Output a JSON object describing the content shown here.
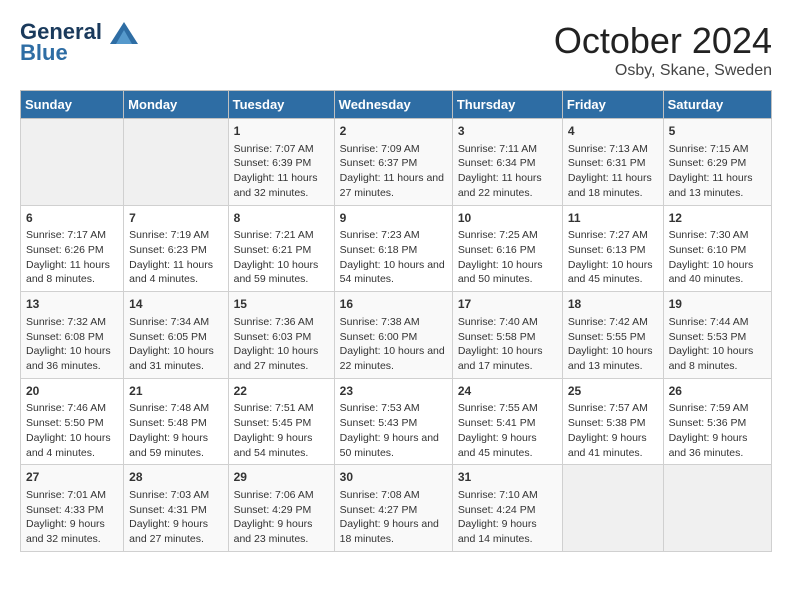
{
  "header": {
    "logo_line1": "General",
    "logo_line2": "Blue",
    "month": "October 2024",
    "location": "Osby, Skane, Sweden"
  },
  "weekdays": [
    "Sunday",
    "Monday",
    "Tuesday",
    "Wednesday",
    "Thursday",
    "Friday",
    "Saturday"
  ],
  "weeks": [
    [
      {
        "day": "",
        "empty": true
      },
      {
        "day": "",
        "empty": true
      },
      {
        "day": "1",
        "sunrise": "7:07 AM",
        "sunset": "6:39 PM",
        "daylight": "11 hours and 32 minutes."
      },
      {
        "day": "2",
        "sunrise": "7:09 AM",
        "sunset": "6:37 PM",
        "daylight": "11 hours and 27 minutes."
      },
      {
        "day": "3",
        "sunrise": "7:11 AM",
        "sunset": "6:34 PM",
        "daylight": "11 hours and 22 minutes."
      },
      {
        "day": "4",
        "sunrise": "7:13 AM",
        "sunset": "6:31 PM",
        "daylight": "11 hours and 18 minutes."
      },
      {
        "day": "5",
        "sunrise": "7:15 AM",
        "sunset": "6:29 PM",
        "daylight": "11 hours and 13 minutes."
      }
    ],
    [
      {
        "day": "6",
        "sunrise": "7:17 AM",
        "sunset": "6:26 PM",
        "daylight": "11 hours and 8 minutes."
      },
      {
        "day": "7",
        "sunrise": "7:19 AM",
        "sunset": "6:23 PM",
        "daylight": "11 hours and 4 minutes."
      },
      {
        "day": "8",
        "sunrise": "7:21 AM",
        "sunset": "6:21 PM",
        "daylight": "10 hours and 59 minutes."
      },
      {
        "day": "9",
        "sunrise": "7:23 AM",
        "sunset": "6:18 PM",
        "daylight": "10 hours and 54 minutes."
      },
      {
        "day": "10",
        "sunrise": "7:25 AM",
        "sunset": "6:16 PM",
        "daylight": "10 hours and 50 minutes."
      },
      {
        "day": "11",
        "sunrise": "7:27 AM",
        "sunset": "6:13 PM",
        "daylight": "10 hours and 45 minutes."
      },
      {
        "day": "12",
        "sunrise": "7:30 AM",
        "sunset": "6:10 PM",
        "daylight": "10 hours and 40 minutes."
      }
    ],
    [
      {
        "day": "13",
        "sunrise": "7:32 AM",
        "sunset": "6:08 PM",
        "daylight": "10 hours and 36 minutes."
      },
      {
        "day": "14",
        "sunrise": "7:34 AM",
        "sunset": "6:05 PM",
        "daylight": "10 hours and 31 minutes."
      },
      {
        "day": "15",
        "sunrise": "7:36 AM",
        "sunset": "6:03 PM",
        "daylight": "10 hours and 27 minutes."
      },
      {
        "day": "16",
        "sunrise": "7:38 AM",
        "sunset": "6:00 PM",
        "daylight": "10 hours and 22 minutes."
      },
      {
        "day": "17",
        "sunrise": "7:40 AM",
        "sunset": "5:58 PM",
        "daylight": "10 hours and 17 minutes."
      },
      {
        "day": "18",
        "sunrise": "7:42 AM",
        "sunset": "5:55 PM",
        "daylight": "10 hours and 13 minutes."
      },
      {
        "day": "19",
        "sunrise": "7:44 AM",
        "sunset": "5:53 PM",
        "daylight": "10 hours and 8 minutes."
      }
    ],
    [
      {
        "day": "20",
        "sunrise": "7:46 AM",
        "sunset": "5:50 PM",
        "daylight": "10 hours and 4 minutes."
      },
      {
        "day": "21",
        "sunrise": "7:48 AM",
        "sunset": "5:48 PM",
        "daylight": "9 hours and 59 minutes."
      },
      {
        "day": "22",
        "sunrise": "7:51 AM",
        "sunset": "5:45 PM",
        "daylight": "9 hours and 54 minutes."
      },
      {
        "day": "23",
        "sunrise": "7:53 AM",
        "sunset": "5:43 PM",
        "daylight": "9 hours and 50 minutes."
      },
      {
        "day": "24",
        "sunrise": "7:55 AM",
        "sunset": "5:41 PM",
        "daylight": "9 hours and 45 minutes."
      },
      {
        "day": "25",
        "sunrise": "7:57 AM",
        "sunset": "5:38 PM",
        "daylight": "9 hours and 41 minutes."
      },
      {
        "day": "26",
        "sunrise": "7:59 AM",
        "sunset": "5:36 PM",
        "daylight": "9 hours and 36 minutes."
      }
    ],
    [
      {
        "day": "27",
        "sunrise": "7:01 AM",
        "sunset": "4:33 PM",
        "daylight": "9 hours and 32 minutes."
      },
      {
        "day": "28",
        "sunrise": "7:03 AM",
        "sunset": "4:31 PM",
        "daylight": "9 hours and 27 minutes."
      },
      {
        "day": "29",
        "sunrise": "7:06 AM",
        "sunset": "4:29 PM",
        "daylight": "9 hours and 23 minutes."
      },
      {
        "day": "30",
        "sunrise": "7:08 AM",
        "sunset": "4:27 PM",
        "daylight": "9 hours and 18 minutes."
      },
      {
        "day": "31",
        "sunrise": "7:10 AM",
        "sunset": "4:24 PM",
        "daylight": "9 hours and 14 minutes."
      },
      {
        "day": "",
        "empty": true
      },
      {
        "day": "",
        "empty": true
      }
    ]
  ]
}
